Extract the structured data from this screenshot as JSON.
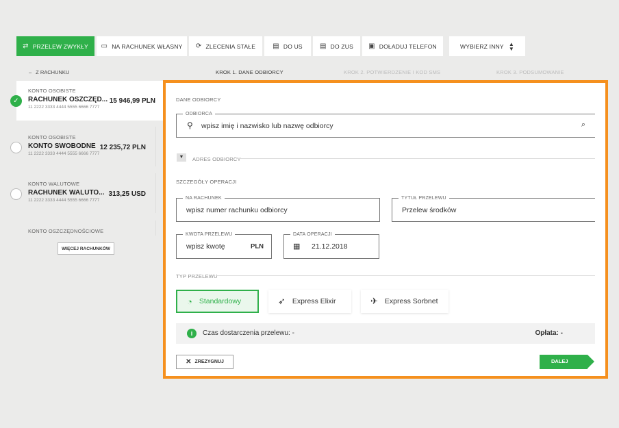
{
  "tabs": [
    {
      "label": "Przelew zwykły",
      "icon": "swap-icon"
    },
    {
      "label": "Na rachunek własny",
      "icon": "card-icon"
    },
    {
      "label": "Zlecenia stałe",
      "icon": "recurring-icon"
    },
    {
      "label": "Do US",
      "icon": "building-icon"
    },
    {
      "label": "Do ZUS",
      "icon": "building-icon"
    },
    {
      "label": "Doładuj telefon",
      "icon": "phone-icon"
    }
  ],
  "more_select": {
    "label": "Wybierz inny"
  },
  "steps": [
    {
      "label": "Krok 1. Dane odbiorcy"
    },
    {
      "label": "Krok 2. Potwierdzenie i kod SMS"
    },
    {
      "label": "Krok 3. Podsumowanie"
    }
  ],
  "from_account_label": "Z rachunku",
  "accounts": [
    {
      "type": "Konto osobiste",
      "name": "RACHUNEK OSZCZĘD...",
      "balance": "15 946,99 PLN",
      "number": "11 2222 3333 4444 5555 6666 7777"
    },
    {
      "type": "Konto osobiste",
      "name": "KONTO SWOBODNE",
      "balance": "12 235,72 PLN",
      "number": "11 2222 3333 4444 5555 6666 7777"
    },
    {
      "type": "Konto walutowe",
      "name": "RACHUNEK WALUTO...",
      "balance": "313,25 USD",
      "number": "11 2222 3333 4444 5555 6666 7777"
    },
    {
      "type": "Konto oszczędnościowe",
      "name": "",
      "balance": "",
      "number": ""
    }
  ],
  "more_accounts": "Więcej rachunków",
  "form": {
    "recipient_section": "Dane odbiorcy",
    "recipient_label": "Odbiorca",
    "recipient_placeholder": "wpisz imię i nazwisko lub nazwę odbiorcy",
    "address_toggle": "Adres odbiorcy",
    "details_section": "Szczegóły operacji",
    "account_label": "Na rachunek",
    "account_placeholder": "wpisz numer rachunku odbiorcy",
    "title_label": "Tytuł przelewu",
    "title_value": "Przelew środków",
    "amount_label": "Kwota przelewu",
    "amount_placeholder": "wpisz kwotę",
    "amount_currency": "PLN",
    "date_label": "Data operacji",
    "date_value": "21.12.2018",
    "type_section": "Typ przelewu",
    "types": [
      {
        "label": "Standardowy",
        "icon": "clock-icon"
      },
      {
        "label": "Express Elixir",
        "icon": "rocket-icon"
      },
      {
        "label": "Express Sorbnet",
        "icon": "plane-icon"
      }
    ],
    "delivery_text": "Czas dostarczenia przelewu: -",
    "fee_text": "Opłata: -",
    "cancel_label": "Zrezygnuj",
    "next_label": "Dalej"
  },
  "colors": {
    "accent": "#2fb04a",
    "highlight": "#f5901e"
  }
}
